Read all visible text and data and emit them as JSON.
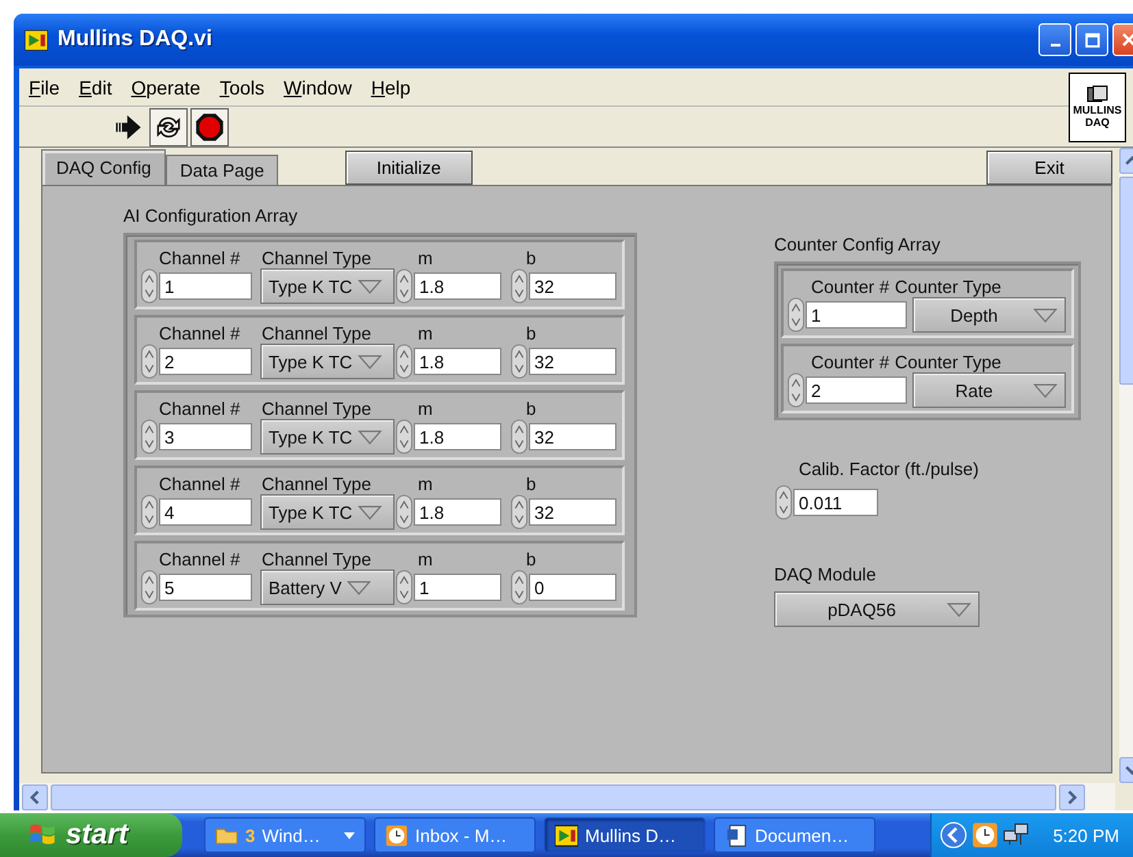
{
  "window": {
    "title": "Mullins DAQ.vi"
  },
  "menu": [
    "File",
    "Edit",
    "Operate",
    "Tools",
    "Window",
    "Help"
  ],
  "vi_icon": {
    "lines": [
      "MULLINS",
      "DAQ"
    ]
  },
  "tabs": [
    {
      "label": "DAQ Config",
      "selected": true
    },
    {
      "label": "Data Page",
      "selected": false
    }
  ],
  "buttons": {
    "initialize": "Initialize",
    "exit": "Exit"
  },
  "ai_array": {
    "label": "AI Configuration Array",
    "elements": [
      {
        "channel_label": "Channel #",
        "type_label": "Channel Type",
        "m_label": "m",
        "b_label": "b",
        "channel": "1",
        "type": "Type K TC",
        "m": "1.8",
        "b": "32"
      },
      {
        "channel_label": "Channel #",
        "type_label": "Channel Type",
        "m_label": "m",
        "b_label": "b",
        "channel": "2",
        "type": "Type K TC",
        "m": "1.8",
        "b": "32"
      },
      {
        "channel_label": "Channel #",
        "type_label": "Channel Type",
        "m_label": "m",
        "b_label": "b",
        "channel": "3",
        "type": "Type K TC",
        "m": "1.8",
        "b": "32"
      },
      {
        "channel_label": "Channel #",
        "type_label": "Channel Type",
        "m_label": "m",
        "b_label": "b",
        "channel": "4",
        "type": "Type K TC",
        "m": "1.8",
        "b": "32"
      },
      {
        "channel_label": "Channel #",
        "type_label": "Channel Type",
        "m_label": "m",
        "b_label": "b",
        "channel": "5",
        "type": "Battery V",
        "m": "1",
        "b": "0"
      }
    ]
  },
  "counter_array": {
    "label": "Counter Config Array",
    "elements": [
      {
        "counter_label": "Counter #",
        "type_label": "Counter Type",
        "counter": "1",
        "type": "Depth"
      },
      {
        "counter_label": "Counter #",
        "type_label": "Counter Type",
        "counter": "2",
        "type": "Rate"
      }
    ]
  },
  "calib": {
    "label": "Calib. Factor (ft./pulse)",
    "value": "0.011"
  },
  "daq_module": {
    "label": "DAQ Module",
    "value": "pDAQ56"
  },
  "taskbar": {
    "start": "start",
    "tasks": [
      {
        "kind": "folder",
        "count": "3",
        "label": "Wind…",
        "selected": false
      },
      {
        "kind": "clock",
        "label": "Inbox - M…",
        "selected": false
      },
      {
        "kind": "vi",
        "label": "Mullins D…",
        "selected": true
      },
      {
        "kind": "doc",
        "label": "Documen…",
        "selected": false
      }
    ],
    "clock": "5:20 PM"
  }
}
